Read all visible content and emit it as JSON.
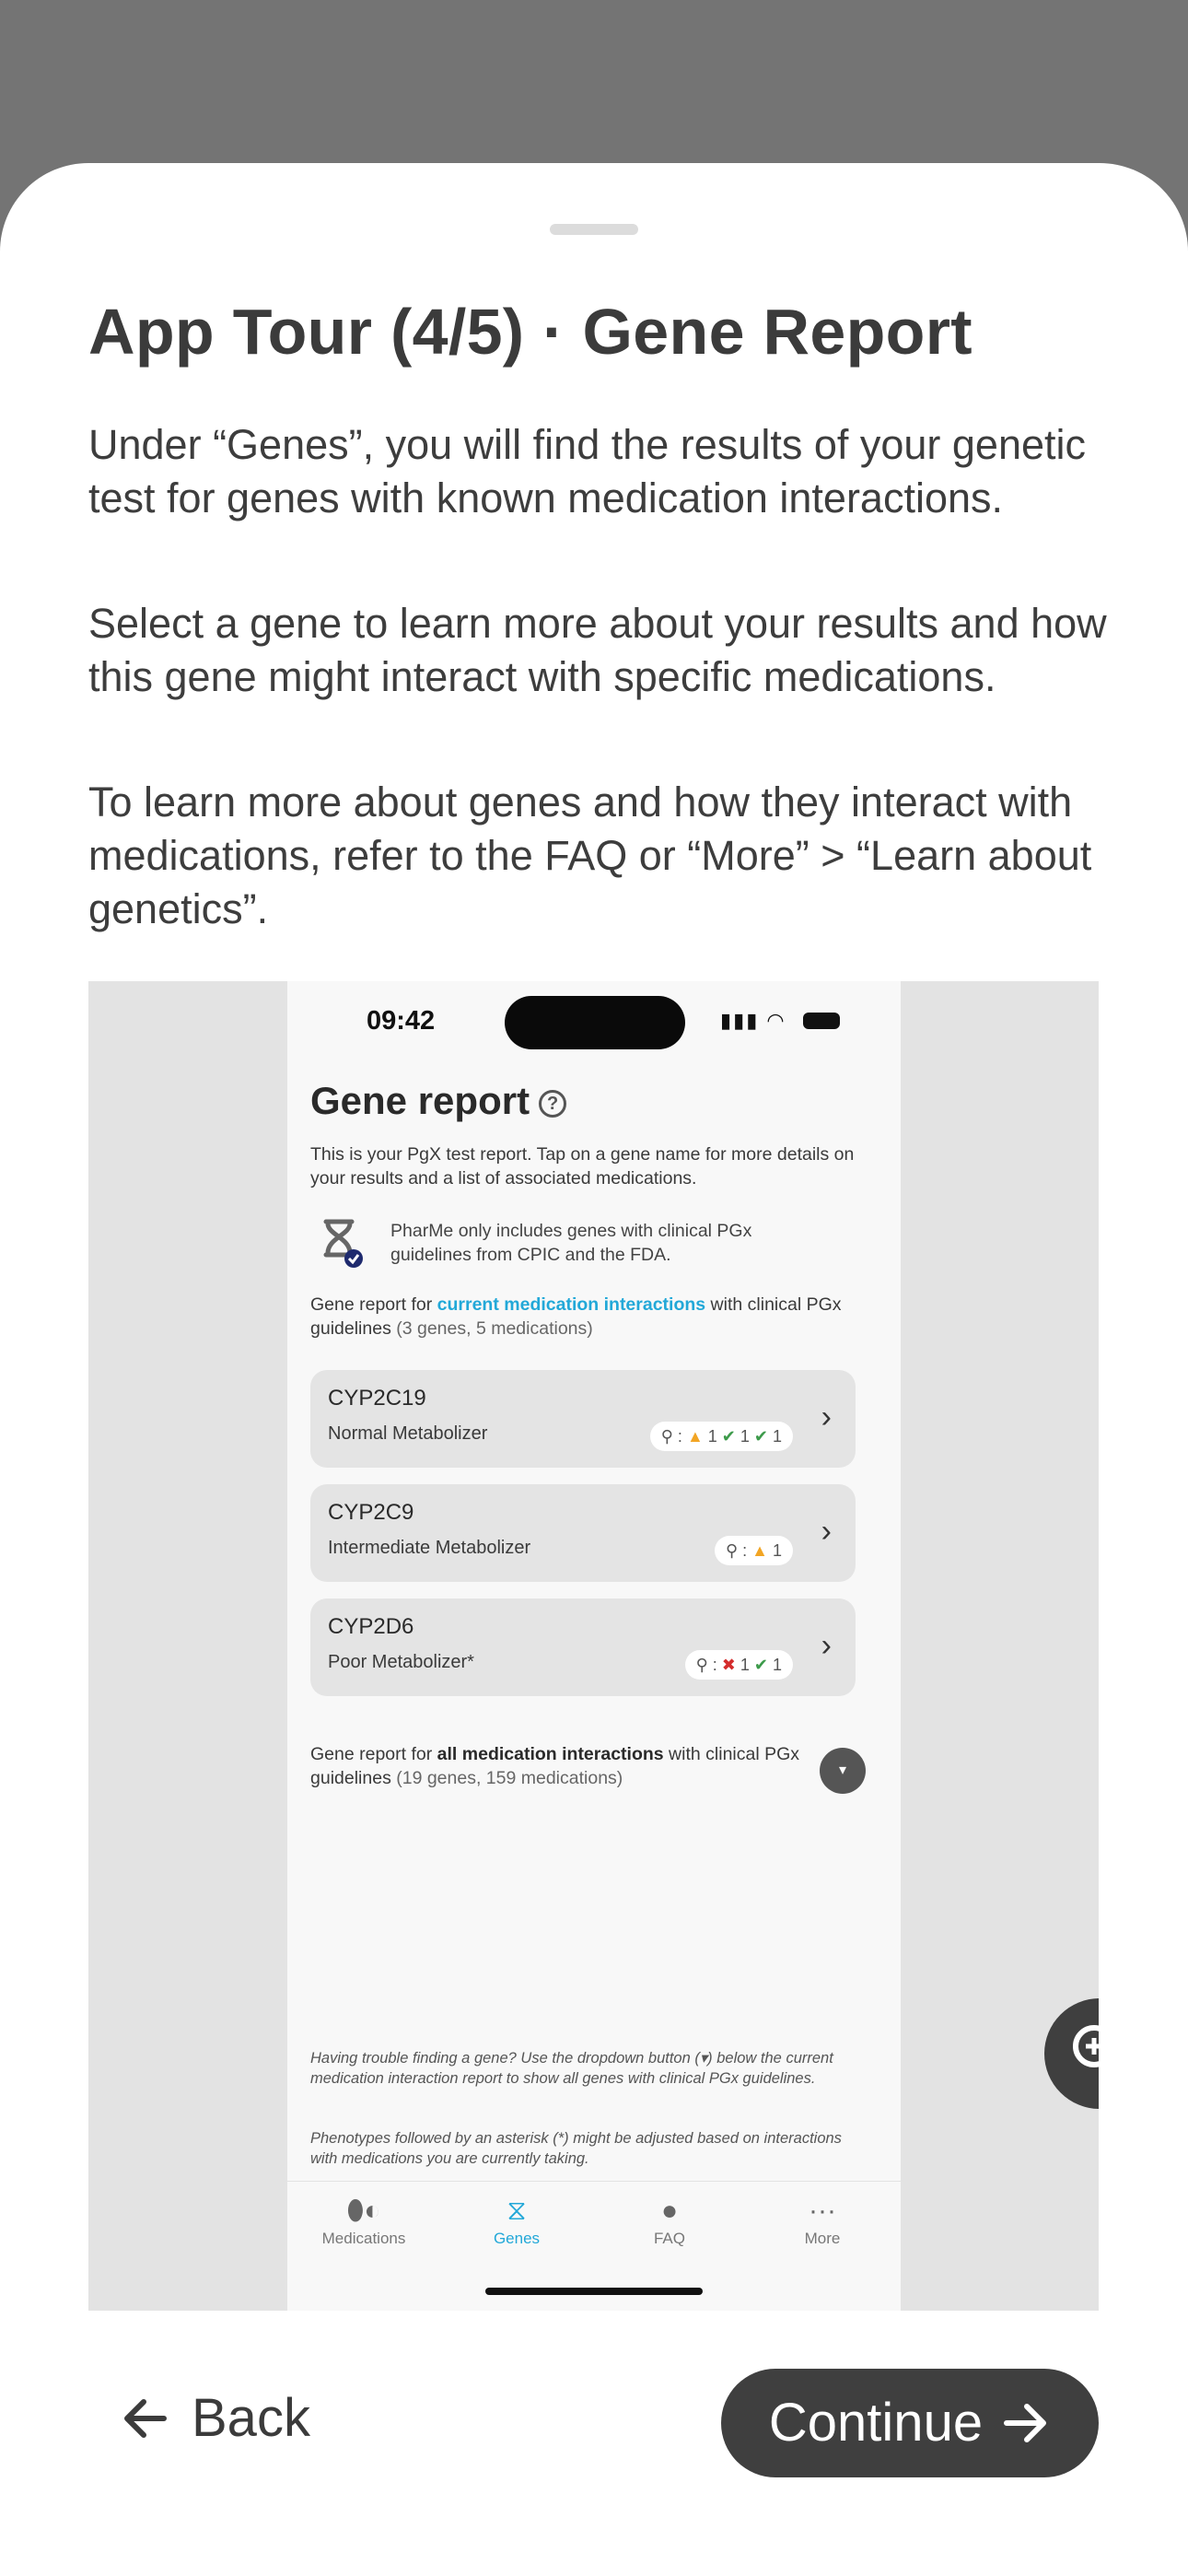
{
  "sheet": {
    "title": "App Tour (4/5) · Gene Report",
    "paragraphs": [
      "Under “Genes”, you will find the results of your genetic test for genes with known medication interactions.",
      "Select a gene to learn more about your results and how this gene might interact with specific medications.",
      "To learn more about genes and how they interact with medications, refer to the FAQ or “More” > “Learn about genetics”."
    ]
  },
  "screenshot": {
    "status_time": "09:42",
    "heading": "Gene report",
    "intro": "This is your PgX test report. Tap on a gene name for more details on your results and a list of associated medications.",
    "note": "PharMe only includes genes with clinical PGx guidelines from CPIC and the FDA.",
    "section1_prefix": "Gene report for ",
    "section1_link": "current medication interactions",
    "section1_suffix": " with clinical PGx guidelines ",
    "section1_count": "(3 genes, 5 medications)",
    "genes": [
      {
        "name": "CYP2C19",
        "phenotype": "Normal Metabolizer",
        "badge": "⚲ : ▲ 1  ✔ 1  ✔ 1"
      },
      {
        "name": "CYP2C9",
        "phenotype": "Intermediate Metabolizer",
        "badge": "⚲ : ▲ 1"
      },
      {
        "name": "CYP2D6",
        "phenotype": "Poor Metabolizer*",
        "badge": "⚲ : ✖ 1  ✔ 1"
      }
    ],
    "section2_prefix": "Gene report for ",
    "section2_bold": "all medication interactions",
    "section2_suffix": " with clinical PGx guidelines ",
    "section2_count": "(19 genes, 159 medications)",
    "footnote1": "Having trouble finding a gene? Use the dropdown button (▾) below the current medication interaction report to show all genes with clinical PGx guidelines.",
    "footnote2": "Phenotypes followed by an asterisk (*) might be adjusted based on interactions with medications you are currently taking.",
    "nav": [
      {
        "label": "Medications",
        "icon": "pills-icon"
      },
      {
        "label": "Genes",
        "icon": "dna-icon"
      },
      {
        "label": "FAQ",
        "icon": "lightbulb-icon"
      },
      {
        "label": "More",
        "icon": "ellipsis-icon"
      }
    ]
  },
  "buttons": {
    "back": "Back",
    "continue": "Continue"
  },
  "colors": {
    "accent": "#22a8d8",
    "primary_button": "#3f3f3f",
    "backdrop": "#747474"
  }
}
